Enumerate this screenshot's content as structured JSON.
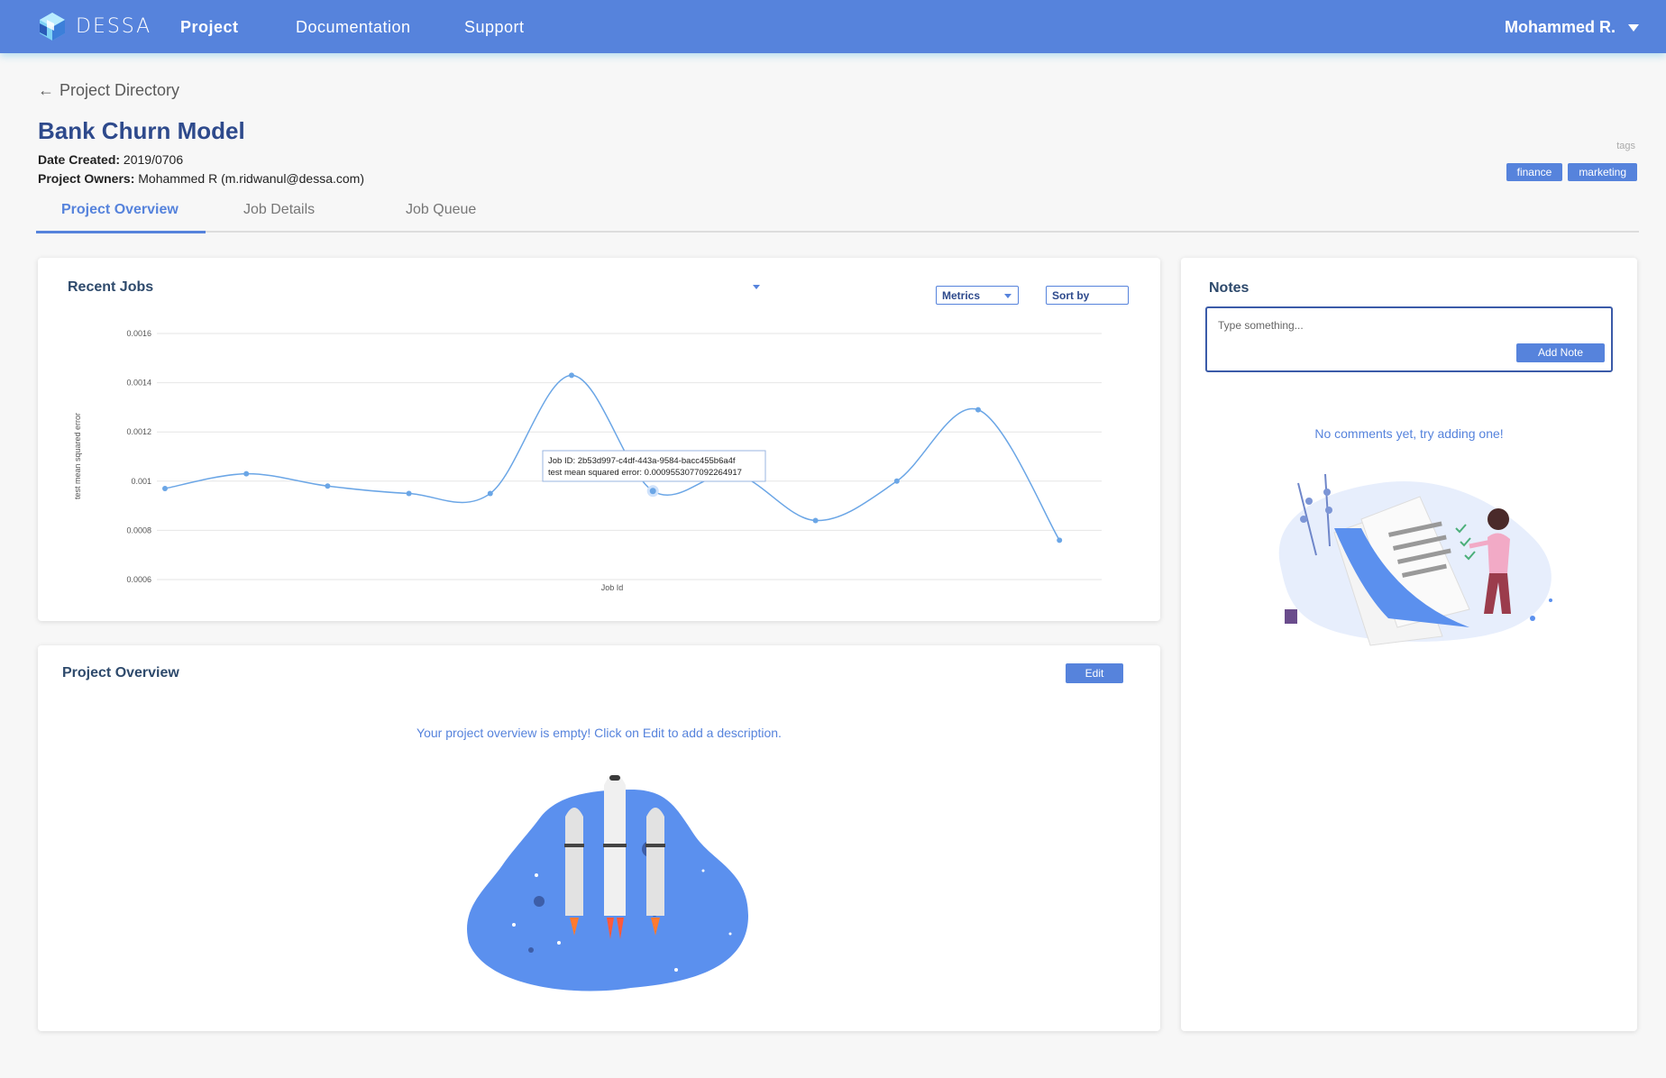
{
  "nav": {
    "logo_text": "DESSA",
    "links": [
      "Project",
      "Documentation",
      "Support"
    ],
    "user_name": "Mohammed R."
  },
  "header": {
    "back_label": "Project Directory",
    "title": "Bank Churn Model",
    "date_created_label": "Date Created:",
    "date_created": "2019/0706",
    "owners_label": "Project Owners:",
    "owners": "Mohammed R (m.ridwanul@dessa.com)",
    "tags_label": "tags",
    "tags": [
      "finance",
      "marketing"
    ]
  },
  "tabs": [
    "Project Overview",
    "Job Details",
    "Job Queue"
  ],
  "recent_jobs": {
    "title": "Recent Jobs",
    "metrics_label": "Metrics",
    "sort_label": "Sort by",
    "tooltip_line1": "Job ID: 2b53d997-c4df-443a-9584-bacc455b6a4f",
    "tooltip_line2": "test mean squared error: 0.0009553077092264917"
  },
  "overview": {
    "title": "Project Overview",
    "edit_label": "Edit",
    "empty_message": "Your project overview is empty! Click on Edit to add a description."
  },
  "notes": {
    "title": "Notes",
    "placeholder": "Type something...",
    "add_label": "Add Note",
    "empty_message": "No comments yet, try adding one!"
  },
  "colors": {
    "accent": "#5683dc",
    "title": "#2e4a8c"
  },
  "chart_data": {
    "type": "line",
    "xlabel": "Job Id",
    "ylabel": "test mean squared error",
    "ylim": [
      0.0006,
      0.0016
    ],
    "yticks": [
      "0.0006",
      "0.0008",
      "0.001",
      "0.0012",
      "0.0014",
      "0.0016"
    ],
    "ytick_values": [
      0.0006,
      0.0008,
      0.001,
      0.0012,
      0.0014,
      0.0016
    ],
    "values": [
      0.00097,
      0.00103,
      0.00098,
      0.00095,
      0.00095,
      0.00143,
      0.00096,
      0.00103,
      0.00084,
      0.001,
      0.00129,
      0.00076
    ],
    "highlight_index": 6,
    "grid": true
  }
}
